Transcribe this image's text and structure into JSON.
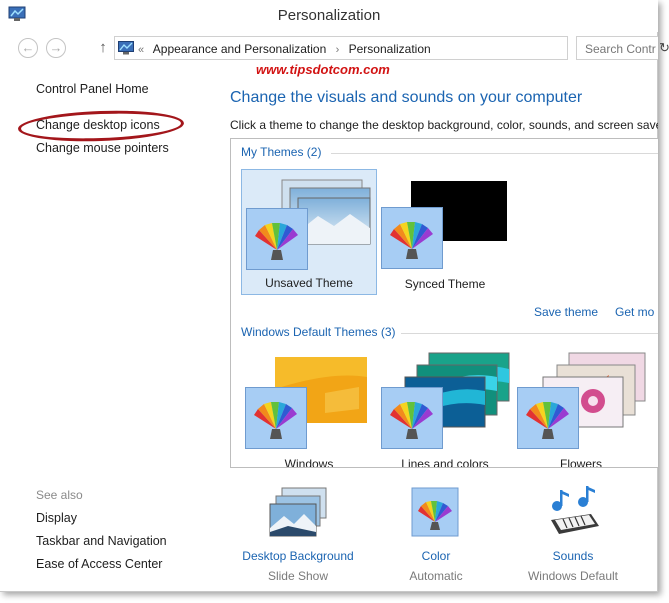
{
  "window": {
    "title": "Personalization"
  },
  "address_bar": {
    "prefix": "«",
    "crumbs": [
      "Appearance and Personalization",
      "Personalization"
    ],
    "separator": "›",
    "search_placeholder": "Search Contr"
  },
  "left_pane": {
    "links": [
      "Control Panel Home",
      "Change desktop icons",
      "Change mouse pointers"
    ],
    "see_also_label": "See also",
    "see_also_links": [
      "Display",
      "Taskbar and Navigation",
      "Ease of Access Center"
    ]
  },
  "watermark": "www.tipsdotcom.com",
  "main": {
    "title": "Change the visuals and sounds on your computer",
    "description": "Click a theme to change the desktop background, color, sounds, and screen save",
    "my_themes_header": "My Themes (2)",
    "my_themes": [
      {
        "label": "Unsaved Theme",
        "selected": true
      },
      {
        "label": "Synced Theme",
        "selected": false
      }
    ],
    "save_theme_link": "Save theme",
    "get_more_link": "Get mo",
    "default_themes_header": "Windows Default Themes (3)",
    "default_themes": [
      {
        "label": "Windows"
      },
      {
        "label": "Lines and colors"
      },
      {
        "label": "Flowers"
      }
    ]
  },
  "bottom_bar": [
    {
      "title": "Desktop Background",
      "subtitle": "Slide Show",
      "icon": "desktop-background-icon"
    },
    {
      "title": "Color",
      "subtitle": "Automatic",
      "icon": "color-palette-icon"
    },
    {
      "title": "Sounds",
      "subtitle": "Windows Default",
      "icon": "sounds-icon"
    }
  ],
  "colors": {
    "link": "#1b64b1",
    "annotation": "#a3161b",
    "watermark": "#d21414",
    "selection": "#dbeaf8"
  }
}
